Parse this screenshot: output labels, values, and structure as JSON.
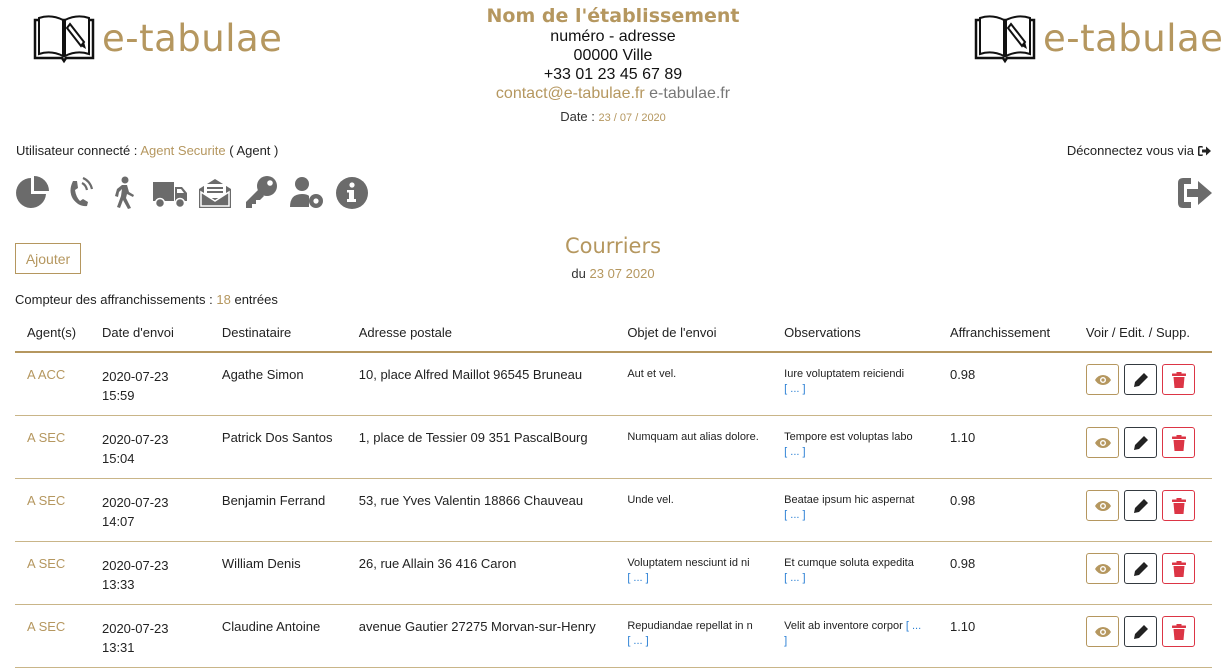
{
  "colors": {
    "accent": "#b5975f",
    "icon_grey": "#6b6b6b",
    "danger": "#dc3545",
    "link": "#2a7fd4"
  },
  "brand": {
    "name": "e-tabulae",
    "logo_icon": "book-pen-icon"
  },
  "establishment": {
    "name": "Nom de l'établissement",
    "address_line": "numéro - adresse",
    "city_line": "00000 Ville",
    "phone": "+33 01 23 45 67 89",
    "email": "contact@e-tabulae.fr",
    "website": "e-tabulae.fr",
    "date_label": "Date :",
    "date_value": "23 / 07 / 2020"
  },
  "user": {
    "label": "Utilisateur connecté :",
    "name": "Agent Securite",
    "role": "( Agent )",
    "logout_label": "Déconnectez vous via"
  },
  "toolbar": {
    "icons": [
      "pie-chart-icon",
      "phone-volume-icon",
      "walking-person-icon",
      "truck-icon",
      "mail-bulk-icon",
      "key-icon",
      "user-cog-icon",
      "info-circle-icon"
    ],
    "exit_icon": "sign-out-icon"
  },
  "page": {
    "add_button": "Ajouter",
    "title": "Courriers",
    "subtitle_prefix": "du",
    "subtitle_date": "23 07 2020",
    "counter_label": "Compteur des affranchissements :",
    "counter_value": "18",
    "counter_suffix": "entrées"
  },
  "table": {
    "headers": [
      "Agent(s)",
      "Date d'envoi",
      "Destinataire",
      "Adresse postale",
      "Objet de l'envoi",
      "Observations",
      "Affranchissement",
      "Voir / Edit. / Supp."
    ],
    "more_label": "[ ... ]",
    "rows": [
      {
        "agent": "A ACC",
        "date": "2020-07-23",
        "time": "15:59",
        "recipient": "Agathe Simon",
        "address": "10, place Alfred Maillot 96545 Bruneau",
        "object": "Aut et vel.",
        "object_more": "",
        "obs": "Iure voluptatem reiciendi",
        "obs_more": "[ ... ]",
        "postage": "0.98"
      },
      {
        "agent": "A SEC",
        "date": "2020-07-23",
        "time": "15:04",
        "recipient": "Patrick Dos Santos",
        "address": "1, place de Tessier 09 351 PascalBourg",
        "object": "Numquam aut alias dolore.",
        "object_more": "",
        "obs": "Tempore est voluptas labo",
        "obs_more": "[ ... ]",
        "postage": "1.10"
      },
      {
        "agent": "A SEC",
        "date": "2020-07-23",
        "time": "14:07",
        "recipient": "Benjamin Ferrand",
        "address": "53, rue Yves Valentin 18866 Chauveau",
        "object": "Unde vel.",
        "object_more": "",
        "obs": "Beatae ipsum hic aspernat",
        "obs_more": "[ ... ]",
        "postage": "0.98"
      },
      {
        "agent": "A SEC",
        "date": "2020-07-23",
        "time": "13:33",
        "recipient": "William Denis",
        "address": "26, rue Allain 36 416 Caron",
        "object": "Voluptatem nesciunt id ni",
        "object_more": "[ ... ]",
        "obs": "Et cumque soluta expedita",
        "obs_more": "[ ... ]",
        "postage": "0.98"
      },
      {
        "agent": "A SEC",
        "date": "2020-07-23",
        "time": "13:31",
        "recipient": "Claudine Antoine",
        "address": "avenue Gautier 27275 Morvan-sur-Henry",
        "object": "Repudiandae repellat in n",
        "object_more": "[ ... ]",
        "obs": "Velit ab inventore corpor",
        "obs_more": "[ ... ]",
        "postage": "1.10"
      }
    ]
  }
}
